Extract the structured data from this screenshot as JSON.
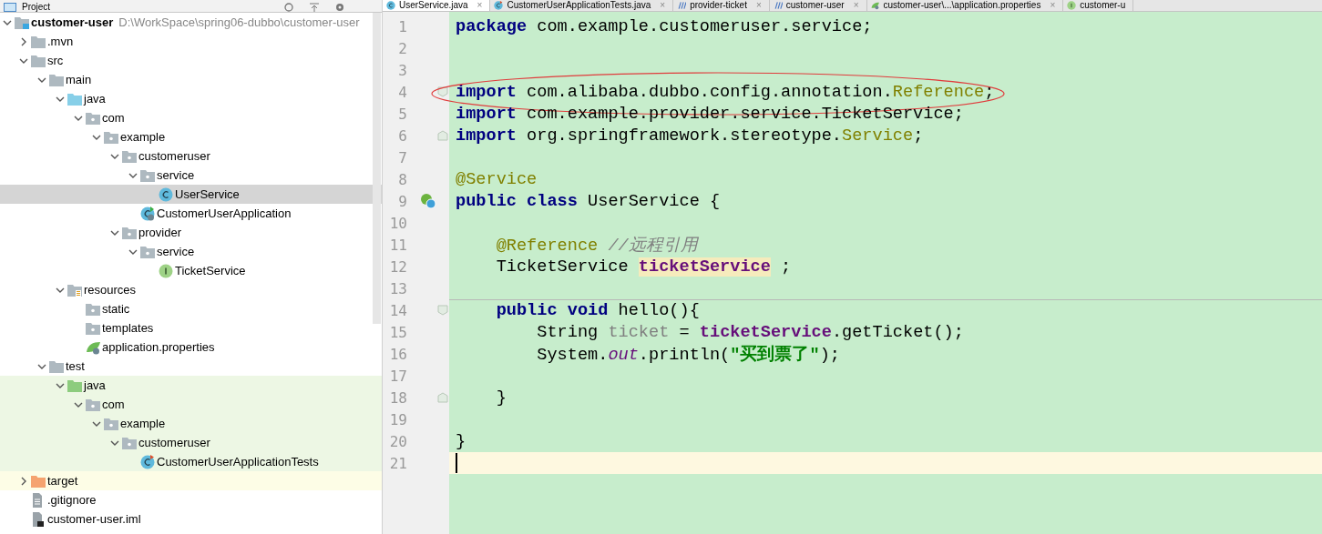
{
  "project_panel": {
    "title": "Project",
    "tree": [
      {
        "kind": "module",
        "name": "customer-user",
        "path": "D:\\WorkSpace\\spring06-dubbo\\customer-user",
        "expanded": true,
        "selected": false,
        "children": [
          {
            "kind": "folder",
            "name": ".mvn",
            "expanded": false,
            "selected": false
          },
          {
            "kind": "folder",
            "name": "src",
            "expanded": true,
            "selected": false,
            "children": [
              {
                "kind": "folder",
                "name": "main",
                "expanded": true,
                "selected": false,
                "children": [
                  {
                    "kind": "source-folder",
                    "name": "java",
                    "expanded": true,
                    "selected": false,
                    "children": [
                      {
                        "kind": "package",
                        "name": "com",
                        "expanded": true,
                        "selected": false,
                        "children": [
                          {
                            "kind": "package",
                            "name": "example",
                            "expanded": true,
                            "selected": false,
                            "children": [
                              {
                                "kind": "package",
                                "name": "customeruser",
                                "expanded": true,
                                "selected": false,
                                "children": [
                                  {
                                    "kind": "package",
                                    "name": "service",
                                    "expanded": true,
                                    "selected": false,
                                    "children": [
                                      {
                                        "kind": "class",
                                        "name": "UserService",
                                        "selected": true
                                      }
                                    ]
                                  },
                                  {
                                    "kind": "spring-app",
                                    "name": "CustomerUserApplication",
                                    "selected": false
                                  }
                                ]
                              },
                              {
                                "kind": "package",
                                "name": "provider",
                                "expanded": true,
                                "selected": false,
                                "children": [
                                  {
                                    "kind": "package",
                                    "name": "service",
                                    "expanded": true,
                                    "selected": false,
                                    "children": [
                                      {
                                        "kind": "interface",
                                        "name": "TicketService",
                                        "selected": false
                                      }
                                    ]
                                  }
                                ]
                              }
                            ]
                          }
                        ]
                      }
                    ]
                  },
                  {
                    "kind": "resources-folder",
                    "name": "resources",
                    "expanded": true,
                    "selected": false,
                    "children": [
                      {
                        "kind": "package",
                        "name": "static",
                        "selected": false
                      },
                      {
                        "kind": "package",
                        "name": "templates",
                        "selected": false
                      },
                      {
                        "kind": "properties",
                        "name": "application.properties",
                        "selected": false
                      }
                    ]
                  }
                ]
              },
              {
                "kind": "folder",
                "name": "test",
                "expanded": true,
                "selected": false,
                "children": [
                  {
                    "kind": "test-folder",
                    "name": "java",
                    "expanded": true,
                    "selected": false,
                    "children": [
                      {
                        "kind": "package",
                        "name": "com",
                        "expanded": true,
                        "selected": false,
                        "children": [
                          {
                            "kind": "package",
                            "name": "example",
                            "expanded": true,
                            "selected": false,
                            "children": [
                              {
                                "kind": "package",
                                "name": "customeruser",
                                "expanded": true,
                                "selected": false,
                                "children": [
                                  {
                                    "kind": "test-class",
                                    "name": "CustomerUserApplicationTests",
                                    "selected": false
                                  }
                                ]
                              }
                            ]
                          }
                        ]
                      }
                    ]
                  }
                ]
              }
            ]
          },
          {
            "kind": "excluded-folder",
            "name": "target",
            "expanded": false,
            "selected": false
          },
          {
            "kind": "file",
            "name": ".gitignore",
            "selected": false
          },
          {
            "kind": "module-file",
            "name": "customer-user.iml",
            "selected": false
          }
        ]
      }
    ]
  },
  "editor": {
    "tabs": [
      {
        "kind": "class",
        "label": "UserService.java",
        "close": "×",
        "selected": true
      },
      {
        "kind": "test-class",
        "label": "CustomerUserApplicationTests.java",
        "close": "×",
        "selected": false
      },
      {
        "kind": "maven",
        "label": "provider-ticket",
        "close": "×",
        "selected": false
      },
      {
        "kind": "maven",
        "label": "customer-user",
        "close": "×",
        "selected": false
      },
      {
        "kind": "properties",
        "label": "customer-user\\...\\application.properties",
        "close": "×",
        "selected": false
      },
      {
        "kind": "interface",
        "label": "customer-u",
        "selected": false
      }
    ],
    "lines": [
      {
        "number": "1",
        "current": false,
        "separator": false,
        "circled": false,
        "tokens": [
          {
            "kind": "keyword",
            "text": "package"
          },
          {
            "kind": "plain",
            "text": " com.example.customeruser.service;"
          }
        ]
      },
      {
        "number": "2",
        "current": false,
        "separator": false,
        "circled": false
      },
      {
        "number": "3",
        "current": false,
        "separator": false,
        "circled": false
      },
      {
        "number": "4",
        "kind": "fold-start",
        "current": false,
        "separator": false,
        "circled": true,
        "tokens": [
          {
            "kind": "keyword",
            "text": "import"
          },
          {
            "kind": "plain",
            "text": " com.alibaba.dubbo.config.annotation."
          },
          {
            "kind": "annotation",
            "text": "Reference"
          },
          {
            "kind": "plain",
            "text": ";"
          }
        ]
      },
      {
        "number": "5",
        "current": false,
        "separator": false,
        "circled": false,
        "tokens": [
          {
            "kind": "keyword",
            "text": "import"
          },
          {
            "kind": "plain",
            "text": " com.example.provider.service.TicketService;"
          }
        ]
      },
      {
        "number": "6",
        "kind": "fold-end",
        "current": false,
        "separator": false,
        "circled": false,
        "tokens": [
          {
            "kind": "keyword",
            "text": "import"
          },
          {
            "kind": "plain",
            "text": " org.springframework.stereotype."
          },
          {
            "kind": "annotation",
            "text": "Service"
          },
          {
            "kind": "plain",
            "text": ";"
          }
        ]
      },
      {
        "number": "7",
        "current": false,
        "separator": false,
        "circled": false
      },
      {
        "number": "8",
        "current": false,
        "separator": false,
        "circled": false,
        "tokens": [
          {
            "kind": "annotation",
            "text": "@Service"
          }
        ]
      },
      {
        "number": "9",
        "kind": "bean",
        "current": false,
        "separator": false,
        "circled": false,
        "tokens": [
          {
            "kind": "keyword",
            "text": "public class"
          },
          {
            "kind": "plain",
            "text": " UserService {"
          }
        ]
      },
      {
        "number": "10",
        "current": false,
        "separator": false,
        "circled": false
      },
      {
        "number": "11",
        "current": false,
        "separator": false,
        "circled": false,
        "tokens": [
          {
            "kind": "annotation",
            "text": "    @Reference"
          },
          {
            "kind": "comment",
            "text": " //远程引用"
          }
        ]
      },
      {
        "number": "12",
        "current": false,
        "separator": false,
        "circled": false,
        "tokens": [
          {
            "kind": "plain",
            "text": "    TicketService "
          },
          {
            "kind": "field-highlight",
            "text": "ticketService"
          },
          {
            "kind": "plain",
            "text": " ;"
          }
        ]
      },
      {
        "number": "13",
        "current": false,
        "separator": false,
        "circled": false
      },
      {
        "number": "14",
        "kind": "fold-start",
        "current": false,
        "separator": true,
        "circled": false,
        "tokens": [
          {
            "kind": "keyword",
            "text": "    public void"
          },
          {
            "kind": "plain",
            "text": " hello(){"
          }
        ]
      },
      {
        "number": "15",
        "current": false,
        "separator": false,
        "circled": false,
        "tokens": [
          {
            "kind": "plain",
            "text": "        String "
          },
          {
            "kind": "unused",
            "text": "ticket"
          },
          {
            "kind": "plain",
            "text": " = "
          },
          {
            "kind": "field",
            "text": "ticketService"
          },
          {
            "kind": "plain",
            "text": ".getTicket();"
          }
        ]
      },
      {
        "number": "16",
        "current": false,
        "separator": false,
        "circled": false,
        "tokens": [
          {
            "kind": "plain",
            "text": "        System."
          },
          {
            "kind": "static",
            "text": "out"
          },
          {
            "kind": "plain",
            "text": ".println("
          },
          {
            "kind": "string",
            "text": "\"买到票了\""
          },
          {
            "kind": "plain",
            "text": ");"
          }
        ]
      },
      {
        "number": "17",
        "current": false,
        "separator": false,
        "circled": false
      },
      {
        "number": "18",
        "kind": "fold-end",
        "current": false,
        "separator": false,
        "circled": false,
        "tokens": [
          {
            "kind": "plain",
            "text": "    }"
          }
        ]
      },
      {
        "number": "19",
        "current": false,
        "separator": false,
        "circled": false
      },
      {
        "number": "20",
        "current": false,
        "separator": false,
        "circled": false,
        "tokens": [
          {
            "kind": "plain",
            "text": "}"
          }
        ]
      },
      {
        "number": "21",
        "current": true,
        "separator": false,
        "circled": false
      }
    ]
  }
}
